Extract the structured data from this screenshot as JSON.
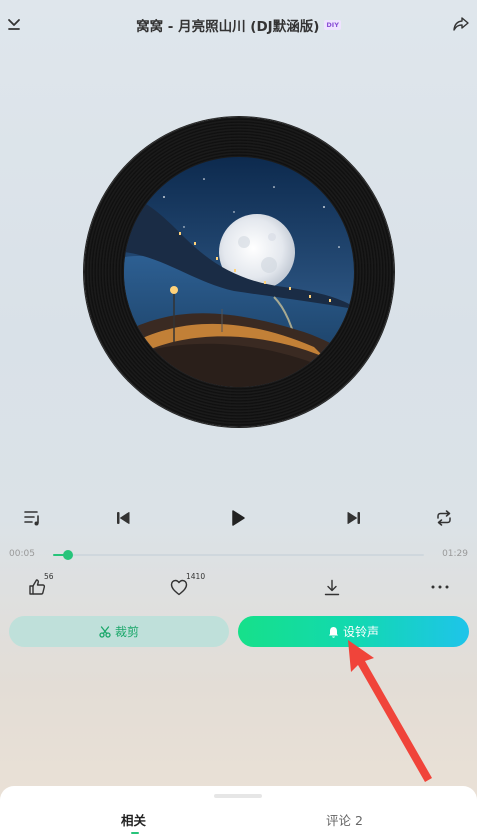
{
  "header": {
    "title": "窝窝 - 月亮照山川 (DJ默涵版)",
    "badge": "DIY",
    "left_icon": "collapse-down-icon",
    "right_icon": "share-icon"
  },
  "player": {
    "current_time": "00:05",
    "total_time": "01:29",
    "progress": 0.04,
    "state": "paused"
  },
  "controls": {
    "playlist_icon": "playlist-icon",
    "prev_icon": "skip-previous-icon",
    "play_icon": "play-icon",
    "next_icon": "skip-next-icon",
    "repeat_icon": "repeat-icon"
  },
  "actions": {
    "like_count": "56",
    "favorite_count": "1410",
    "download_icon": "download-icon",
    "more_icon": "more-icon"
  },
  "buttons": {
    "cut_label": "裁剪",
    "ringtone_label": "设铃声"
  },
  "tabs": [
    {
      "label": "相关",
      "active": true
    },
    {
      "label": "评论 2",
      "active": false
    }
  ],
  "colors": {
    "accent": "#27c47a",
    "ringtone_gradient_start": "#16e08a",
    "ringtone_gradient_end": "#1ec4ea",
    "annotation_arrow": "#f0443a"
  }
}
